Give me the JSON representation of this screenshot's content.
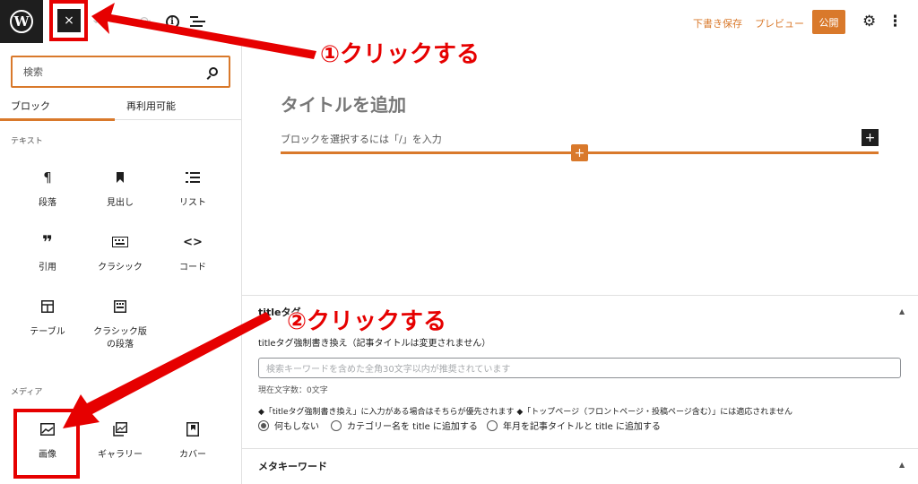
{
  "header": {
    "logo_letter": "W",
    "close_label": "×",
    "save_draft": "下書き保存",
    "preview": "プレビュー",
    "publish": "公開"
  },
  "sidebar": {
    "search_placeholder": "検索",
    "tabs": [
      "ブロック",
      "再利用可能"
    ],
    "text_category": "テキスト",
    "text_blocks": [
      {
        "label": "段落",
        "icon": "paragraph-icon"
      },
      {
        "label": "見出し",
        "icon": "bookmark-icon"
      },
      {
        "label": "リスト",
        "icon": "list-icon"
      },
      {
        "label": "引用",
        "icon": "quote-icon"
      },
      {
        "label": "クラシック",
        "icon": "keyboard-icon"
      },
      {
        "label": "コード",
        "icon": "code-icon"
      },
      {
        "label": "テーブル",
        "icon": "table-icon"
      },
      {
        "label": "クラシック版の段落",
        "icon": "classic-paragraph-icon"
      }
    ],
    "media_category": "メディア",
    "media_blocks": [
      {
        "label": "画像",
        "icon": "image-icon"
      },
      {
        "label": "ギャラリー",
        "icon": "gallery-icon"
      },
      {
        "label": "カバー",
        "icon": "cover-icon"
      }
    ]
  },
  "editor": {
    "title_placeholder": "タイトルを追加",
    "block_placeholder": "ブロックを選択するには「/」を入力"
  },
  "meta": {
    "title_panel": "titleタグ",
    "title_desc": "titleタグ強制書き換え（記事タイトルは変更されません）",
    "input_placeholder": "検索キーワードを含めた全角30文字以内が推奨されています",
    "char_count": "現在文字数：0文字",
    "note": "◆「titleタグ強制書き換え」に入力がある場合はそちらが優先されます ◆「トップページ（フロントページ・投稿ページ含む）」には適応されません",
    "options": [
      "何もしない",
      "カテゴリー名を title に追加する",
      "年月を記事タイトルと title に追加する"
    ],
    "selected_option": "何もしない",
    "keywords_panel": "メタキーワード"
  },
  "annotations": {
    "step1": "①クリックする",
    "step2": "②クリックする"
  },
  "colors": {
    "accent": "#d9792b",
    "annotation_red": "#e60000",
    "dark": "#1e1e1e"
  }
}
